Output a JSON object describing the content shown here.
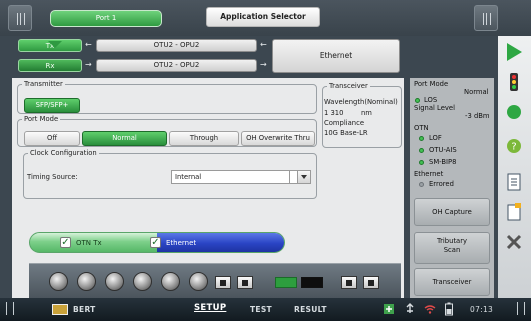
{
  "header": {
    "port_tab": "Port 1",
    "app_selector": "Application Selector"
  },
  "signal_path": {
    "tx_label": "Tx",
    "rx_label": "Rx",
    "tx_signal": "OTU2 - OPU2",
    "rx_signal": "OTU2 - OPU2",
    "payload": "Ethernet"
  },
  "transmitter": {
    "legend": "Transmitter",
    "interface_button": "SFP/SFP+"
  },
  "port_mode": {
    "legend": "Port Mode",
    "options": [
      "Off",
      "Normal",
      "Through",
      "OH Overwrite Thru"
    ],
    "selected_index": 1
  },
  "clock": {
    "legend": "Clock Configuration",
    "timing_label": "Timing Source:",
    "timing_value": "Internal"
  },
  "transceiver": {
    "legend": "Transceiver",
    "wavelength_label": "Wavelength(Nominal)",
    "wavelength_value": "1 310",
    "wavelength_unit": "nm",
    "compliance_label": "Compliance",
    "compliance_value": "10G Base-LR"
  },
  "status": {
    "port_mode_label": "Port Mode",
    "port_mode_value": "Normal",
    "los_label": "LOS",
    "signal_level_label": "Signal Level",
    "signal_level_value": "-3 dBm",
    "otn_label": "OTN",
    "otn_alarms": [
      "LOF",
      "OTU-AIS",
      "SM-BIP8"
    ],
    "ethernet_label": "Ethernet",
    "ethernet_alarm": "Errored",
    "buttons": [
      "OH Capture",
      "Tributary Scan",
      "Transceiver"
    ]
  },
  "pipe": {
    "otn_tx": "OTN Tx",
    "ethernet": "Ethernet"
  },
  "bottom_bar": {
    "app": "BERT",
    "tabs": [
      "SETUP",
      "TEST",
      "RESULT"
    ],
    "active_tab": "SETUP",
    "time": "07:13"
  },
  "colors": {
    "accent_green": "#2f9a41",
    "pipe_blue": "#2a44c4",
    "panel_bg": "#e9eaeb"
  }
}
